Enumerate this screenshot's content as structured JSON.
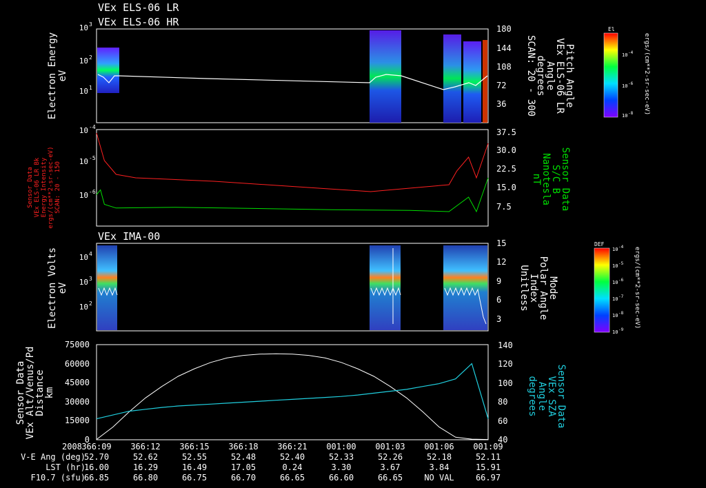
{
  "header": {
    "title_lr": "VEx ELS-06 LR",
    "title_hr": "VEx ELS-06 HR"
  },
  "panels": {
    "p1": {
      "ylabel": [
        "Electron Energy",
        "eV"
      ],
      "yticks": [
        "10",
        "10",
        "10"
      ],
      "yexps": [
        "1",
        "2",
        "3"
      ],
      "rticks": [
        "180",
        "144",
        "108",
        "72",
        "36"
      ],
      "rlabel": [
        "Pitch Angle",
        "VEx ELS-06 LR",
        "Angle",
        "degrees",
        "SCAN: 20 - 300"
      ],
      "cbar_title": "El",
      "cbar_ticks": [
        "10",
        "10",
        "10"
      ],
      "cbar_exps": [
        "-4",
        "-6",
        "-8"
      ],
      "cbar_units": "ergs/(cm**2-sr-sec-eV)"
    },
    "p2": {
      "ylabel": [
        "Sensor Data",
        "VEx ELS-06 LR Bk",
        "Energy Intensity",
        "ergs/(cm**2-sr-sec-eV)",
        "SCAN: 20 - 150"
      ],
      "yticks": [
        "10",
        "10",
        "10"
      ],
      "yexps": [
        "-4",
        "-5",
        "-6"
      ],
      "rticks": [
        "37.5",
        "30.0",
        "22.5",
        "15.0",
        "7.5"
      ],
      "rlabel": [
        "Sensor Data",
        "S/C B",
        "Nanotesla",
        "nT"
      ]
    },
    "p3": {
      "title": "VEx IMA-00",
      "ylabel": [
        "Electron Volts",
        "eV"
      ],
      "yticks": [
        "10",
        "10",
        "10"
      ],
      "yexps": [
        "4",
        "3",
        "2"
      ],
      "rticks": [
        "15",
        "12",
        "9",
        "6",
        "3"
      ],
      "rlabel": [
        "Mode",
        "Polar Angle",
        "Index",
        "Unitless"
      ],
      "cbar_title": "DEF",
      "cbar_ticks": [
        "10",
        "10",
        "10",
        "10",
        "10",
        "10"
      ],
      "cbar_exps": [
        "-4",
        "-5",
        "-6",
        "-7",
        "-8",
        "-9"
      ],
      "cbar_units": "ergs/(cm**2-sr-sec-eV)"
    },
    "p4": {
      "ylabel": [
        "Sensor Data",
        "VEx Alt/Venus/Pd",
        "Distance",
        "km"
      ],
      "yticks": [
        "75000",
        "60000",
        "45000",
        "30000",
        "15000",
        "0"
      ],
      "rticks": [
        "140",
        "120",
        "100",
        "80",
        "60",
        "40"
      ],
      "rlabel": [
        "Sensor Data",
        "VEx SZA",
        "Angle",
        "degrees"
      ]
    }
  },
  "colors": {
    "red": "#ff2020",
    "green": "#00e000",
    "cyan": "#20d0e0",
    "white": "#ffffff"
  },
  "chart_data": [
    {
      "type": "line",
      "panel": "p4",
      "x": [
        "366:09",
        "366:10",
        "366:11",
        "366:12",
        "366:13",
        "366:14",
        "366:15",
        "366:16",
        "366:17",
        "366:18",
        "366:19",
        "366:20",
        "366:21",
        "366:22",
        "366:23",
        "001:00",
        "001:01",
        "001:02",
        "001:03",
        "001:04",
        "001:05",
        "001:06",
        "001:07",
        "001:08",
        "001:09"
      ],
      "series": [
        {
          "name": "VEx Alt/Venus/Pd",
          "axis": "left",
          "values": [
            200,
            10000,
            22000,
            33000,
            42000,
            50000,
            56000,
            61000,
            64500,
            66500,
            67500,
            67800,
            67500,
            66500,
            64500,
            61000,
            56000,
            50000,
            42000,
            33000,
            22000,
            10000,
            2000,
            500,
            200
          ]
        },
        {
          "name": "VEx SZA",
          "axis": "right",
          "values": [
            62,
            66,
            70,
            72,
            74,
            75.5,
            76.5,
            77.5,
            78.5,
            79.5,
            80.5,
            81.5,
            82.5,
            83.5,
            84.5,
            85.5,
            87,
            89,
            91,
            93,
            96,
            99,
            104,
            120,
            62
          ]
        }
      ],
      "ylim_left": [
        0,
        75000
      ],
      "ylim_right": [
        40,
        140
      ]
    },
    {
      "type": "line",
      "panel": "p2",
      "series": [
        {
          "name": "VEx ELS-06 LR Bk",
          "axis": "left",
          "points": [
            [
              0,
              -4.1
            ],
            [
              0.02,
              -4.9
            ],
            [
              0.05,
              -5.3
            ],
            [
              0.1,
              -5.4
            ],
            [
              0.3,
              -5.5
            ],
            [
              0.5,
              -5.65
            ],
            [
              0.7,
              -5.8
            ],
            [
              0.8,
              -5.7
            ],
            [
              0.9,
              -5.6
            ],
            [
              0.92,
              -5.2
            ],
            [
              0.95,
              -4.8
            ],
            [
              0.97,
              -5.4
            ],
            [
              1.0,
              -4.4
            ]
          ]
        },
        {
          "name": "S/C B",
          "axis": "right",
          "points": [
            [
              0,
              13
            ],
            [
              0.01,
              15
            ],
            [
              0.02,
              9
            ],
            [
              0.05,
              7.5
            ],
            [
              0.2,
              7.8
            ],
            [
              0.4,
              7.3
            ],
            [
              0.6,
              6.8
            ],
            [
              0.8,
              6.5
            ],
            [
              0.9,
              6
            ],
            [
              0.95,
              12
            ],
            [
              0.97,
              6
            ],
            [
              1.0,
              20
            ]
          ]
        }
      ]
    }
  ],
  "xaxis": {
    "year": "2008",
    "ticks": [
      "366:09",
      "366:12",
      "366:15",
      "366:18",
      "366:21",
      "001:00",
      "001:03",
      "001:06",
      "001:09"
    ],
    "rows": [
      {
        "label": "V-E Ang (deg)",
        "values": [
          "52.70",
          "52.62",
          "52.55",
          "52.48",
          "52.40",
          "52.33",
          "52.26",
          "52.18",
          "52.11"
        ]
      },
      {
        "label": "LST (hr)",
        "values": [
          "16.00",
          "16.29",
          "16.49",
          "17.05",
          "0.24",
          "3.30",
          "3.67",
          "3.84",
          "15.91"
        ]
      },
      {
        "label": "F10.7 (sfu)",
        "values": [
          "66.85",
          "66.80",
          "66.75",
          "66.70",
          "66.65",
          "66.60",
          "66.65",
          "NO VAL",
          "66.97"
        ]
      }
    ]
  }
}
